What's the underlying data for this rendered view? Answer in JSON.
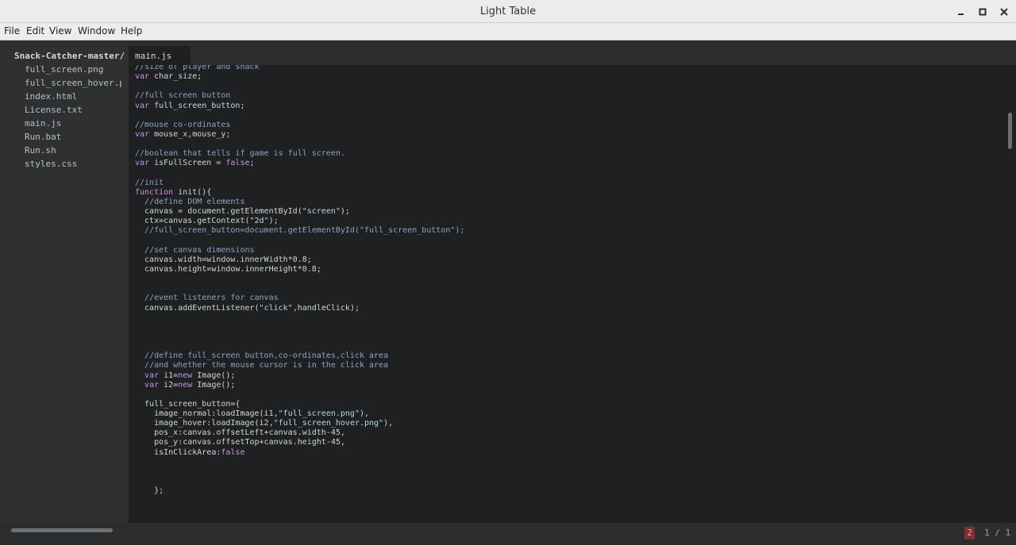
{
  "window": {
    "title": "Light Table"
  },
  "menu": {
    "items": [
      "File",
      "Edit",
      "View",
      "Window",
      "Help"
    ]
  },
  "sidebar": {
    "folder": "Snack-Catcher-master/",
    "files": [
      "full_screen.png",
      "full_screen_hover.png",
      "index.html",
      "License.txt",
      "main.js",
      "Run.bat",
      "Run.sh",
      "styles.css"
    ]
  },
  "tabs": [
    {
      "label": "main.js",
      "active": true
    }
  ],
  "status": {
    "errors": "2",
    "page": "1 / 1"
  },
  "colors": {
    "comment": "#8fa2c7",
    "keyword": "#c792ea",
    "string": "#b5d7e8",
    "error": "#7c2f35"
  },
  "code_lines": [
    [
      [
        "c",
        "//size of player and snack"
      ]
    ],
    [
      [
        "k",
        "var"
      ],
      [
        "t",
        " char_size;"
      ]
    ],
    [],
    [
      [
        "c",
        "//full screen button"
      ]
    ],
    [
      [
        "k",
        "var"
      ],
      [
        "t",
        " full_screen_button;"
      ]
    ],
    [],
    [
      [
        "c",
        "//mouse co-ordinates"
      ]
    ],
    [
      [
        "k",
        "var"
      ],
      [
        "t",
        " mouse_x,mouse_y;"
      ]
    ],
    [],
    [
      [
        "c",
        "//boolean that tells if game is full screen."
      ]
    ],
    [
      [
        "k",
        "var"
      ],
      [
        "t",
        " isFullScreen = "
      ],
      [
        "k",
        "false"
      ],
      [
        "t",
        ";"
      ]
    ],
    [],
    [
      [
        "c",
        "//init"
      ]
    ],
    [
      [
        "k",
        "function"
      ],
      [
        "t",
        " init(){"
      ]
    ],
    [
      [
        "t",
        "  "
      ],
      [
        "c",
        "//define DOM elements"
      ]
    ],
    [
      [
        "t",
        "  canvas = document.getElementById("
      ],
      [
        "s",
        "\"screen\""
      ],
      [
        "t",
        ");"
      ]
    ],
    [
      [
        "t",
        "  ctx=canvas.getContext("
      ],
      [
        "s",
        "\"2d\""
      ],
      [
        "t",
        ");"
      ]
    ],
    [
      [
        "t",
        "  "
      ],
      [
        "c",
        "//full_screen_button=document.getElementById(\"full_screen_button\");"
      ]
    ],
    [],
    [
      [
        "t",
        "  "
      ],
      [
        "c",
        "//set canvas dimensions"
      ]
    ],
    [
      [
        "t",
        "  canvas.width=window.innerWidth*0.8;"
      ]
    ],
    [
      [
        "t",
        "  canvas.height=window.innerHeight*0.8;"
      ]
    ],
    [],
    [],
    [
      [
        "t",
        "  "
      ],
      [
        "c",
        "//event listeners for canvas"
      ]
    ],
    [
      [
        "t",
        "  canvas.addEventListener("
      ],
      [
        "s",
        "\"click\""
      ],
      [
        "t",
        ",handleClick);"
      ]
    ],
    [],
    [],
    [],
    [],
    [
      [
        "t",
        "  "
      ],
      [
        "c",
        "//define full_screen button,co-ordinates,click area"
      ]
    ],
    [
      [
        "t",
        "  "
      ],
      [
        "c",
        "//and whether the mouse cursor is in the click area"
      ]
    ],
    [
      [
        "t",
        "  "
      ],
      [
        "k",
        "var"
      ],
      [
        "t",
        " i1="
      ],
      [
        "k",
        "new"
      ],
      [
        "t",
        " Image();"
      ]
    ],
    [
      [
        "t",
        "  "
      ],
      [
        "k",
        "var"
      ],
      [
        "t",
        " i2="
      ],
      [
        "k",
        "new"
      ],
      [
        "t",
        " Image();"
      ]
    ],
    [],
    [
      [
        "t",
        "  full_screen_button={"
      ]
    ],
    [
      [
        "t",
        "    image_normal:loadImage(i1,"
      ],
      [
        "s",
        "\"full_screen.png\""
      ],
      [
        "t",
        "),"
      ]
    ],
    [
      [
        "t",
        "    image_hover:loadImage(i2,"
      ],
      [
        "s",
        "\"full_screen_hover.png\""
      ],
      [
        "t",
        "),"
      ]
    ],
    [
      [
        "t",
        "    pos_x:canvas.offsetLeft+canvas.width-45,"
      ]
    ],
    [
      [
        "t",
        "    pos_y:canvas.offsetTop+canvas.height-45,"
      ]
    ],
    [
      [
        "t",
        "    isInClickArea:"
      ],
      [
        "k",
        "false"
      ]
    ],
    [],
    [],
    [],
    [
      [
        "t",
        "    };"
      ]
    ]
  ]
}
